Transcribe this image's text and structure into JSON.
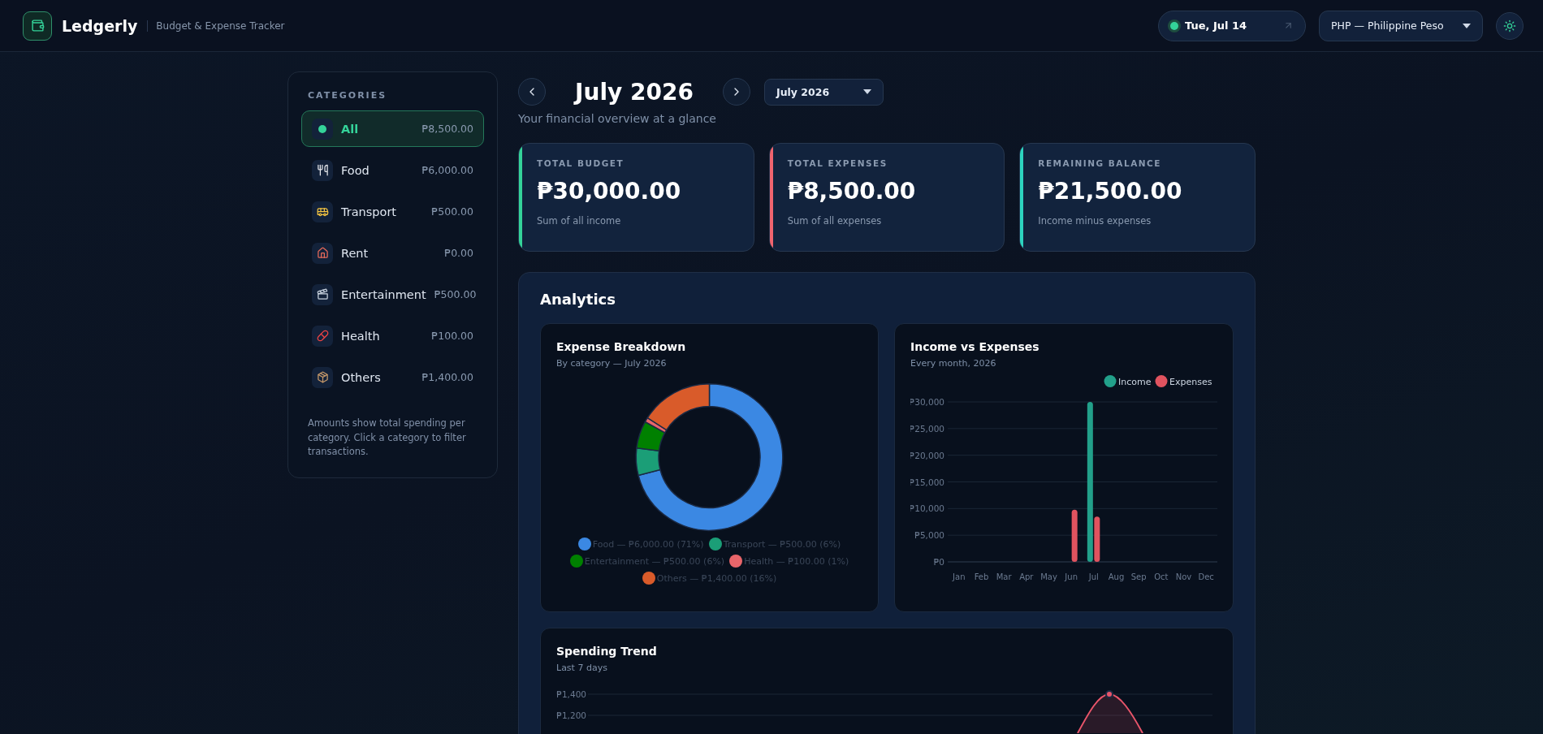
{
  "header": {
    "app_name": "Ledgerly",
    "tagline": "Budget & Expense Tracker",
    "date": "Tue, Jul 14",
    "currency": "PHP — Philippine Peso"
  },
  "sidebar": {
    "title": "CATEGORIES",
    "items": [
      {
        "kind": "all",
        "label": "All",
        "amount": "₱8,500.00",
        "selected": true
      },
      {
        "kind": "category",
        "label": "Food",
        "amount": "₱6,000.00",
        "selected": false
      },
      {
        "kind": "category",
        "label": "Transport",
        "amount": "₱500.00",
        "selected": false
      },
      {
        "kind": "category",
        "label": "Rent",
        "amount": "₱0.00",
        "selected": false
      },
      {
        "kind": "category",
        "label": "Entertainment",
        "amount": "₱500.00",
        "selected": false
      },
      {
        "kind": "category",
        "label": "Health",
        "amount": "₱100.00",
        "selected": false
      },
      {
        "kind": "category",
        "label": "Others",
        "amount": "₱1,400.00",
        "selected": false
      }
    ],
    "note": "Amounts show total spending per category. Click a category to filter transactions."
  },
  "period": {
    "title": "July 2026",
    "picker": "July 2026",
    "subtitle": "Your financial overview at a glance"
  },
  "stats": [
    {
      "label": "TOTAL BUDGET",
      "value": "₱30,000.00",
      "caption": "Sum of all income",
      "color": "#34d399"
    },
    {
      "label": "TOTAL EXPENSES",
      "value": "₱8,500.00",
      "caption": "Sum of all expenses",
      "color": "#f0646e"
    },
    {
      "label": "REMAINING BALANCE",
      "value": "₱21,500.00",
      "caption": "Income minus expenses",
      "color": "#2dd4bf"
    }
  ],
  "analytics": {
    "title": "Analytics",
    "breakdown": {
      "title": "Expense Breakdown",
      "subtitle": "By category — July 2026",
      "chart_data": {
        "type": "donut",
        "values": [
          71,
          6,
          6,
          1,
          16
        ]
      },
      "legend": [
        {
          "label": "Food — ₱6,000.00 (71%)",
          "color": "#3b88e3"
        },
        {
          "label": "Transport — ₱500.00 (6%)",
          "color": "#1b9e77"
        },
        {
          "label": "Entertainment — ₱500.00 (6%)",
          "color": "#008000"
        },
        {
          "label": "Health — ₱100.00 (1%)",
          "color": "#e8656a"
        },
        {
          "label": "Others — ₱1,400.00 (16%)",
          "color": "#d95b2a"
        }
      ]
    },
    "income_expenses": {
      "title": "Income vs Expenses",
      "subtitle": "Every month, 2026",
      "chart_data": {
        "type": "bar",
        "categories": [
          "Jan",
          "Feb",
          "Mar",
          "Apr",
          "May",
          "Jun",
          "Jul",
          "Aug",
          "Sep",
          "Oct",
          "Nov",
          "Dec"
        ],
        "series": [
          {
            "name": "Income",
            "color": "#22a08a",
            "values": [
              0,
              0,
              0,
              0,
              0,
              0,
              30000,
              0,
              0,
              0,
              0,
              0
            ]
          },
          {
            "name": "Expenses",
            "color": "#e0535f",
            "values": [
              0,
              0,
              0,
              0,
              0,
              9800,
              8500,
              0,
              0,
              0,
              0,
              0
            ]
          }
        ],
        "ylim": [
          0,
          30000
        ],
        "grid": true,
        "legend": true,
        "yticks": [
          {
            "value": 0,
            "label": "₱0"
          },
          {
            "value": 5000,
            "label": "₱5,000"
          },
          {
            "value": 10000,
            "label": "₱10,000"
          },
          {
            "value": 15000,
            "label": "₱15,000"
          },
          {
            "value": 20000,
            "label": "₱20,000"
          },
          {
            "value": 25000,
            "label": "₱25,000"
          },
          {
            "value": 30000,
            "label": "₱30,000"
          }
        ]
      }
    },
    "trend": {
      "title": "Spending Trend",
      "subtitle": "Last 7 days",
      "y_axis_labels": [
        "₱1,400",
        "₱1,200"
      ]
    }
  }
}
